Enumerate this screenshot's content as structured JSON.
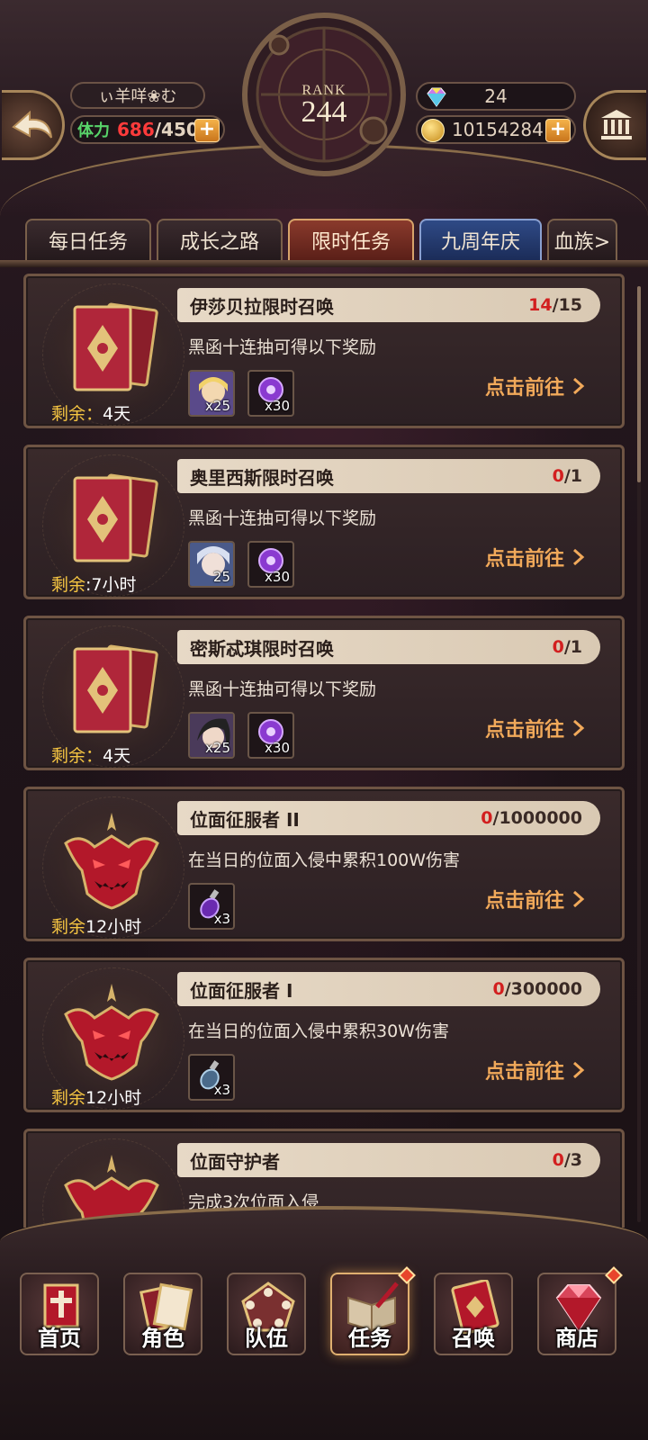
{
  "header": {
    "player_name": "ぃ羊咩❀む",
    "stamina_label": "体力",
    "stamina_current": "686",
    "stamina_max": "/450",
    "rank_label": "RANK",
    "rank_value": "244",
    "gems": "24",
    "gold": "10154284"
  },
  "tabs": [
    {
      "label": "每日任务"
    },
    {
      "label": "成长之路"
    },
    {
      "label": "限时任务"
    },
    {
      "label": "九周年庆"
    },
    {
      "label": "血族>"
    }
  ],
  "tasks": [
    {
      "title": "伊莎贝拉限时召唤",
      "progress_cur": "14",
      "progress_total": "/15",
      "desc": "黑函十连抽可得以下奖励",
      "remain_label": "剩余：",
      "remain_value": "4天",
      "reward1_qty": "x25",
      "reward2_qty": "x30",
      "goto": "点击前往"
    },
    {
      "title": "奥里西斯限时召唤",
      "progress_cur": "0",
      "progress_total": "/1",
      "desc": "黑函十连抽可得以下奖励",
      "remain_label": "剩余",
      "remain_value": ":7小时",
      "reward1_qty": "25",
      "reward2_qty": "x30",
      "goto": "点击前往"
    },
    {
      "title": "密斯忒琪限时召唤",
      "progress_cur": "0",
      "progress_total": "/1",
      "desc": "黑函十连抽可得以下奖励",
      "remain_label": "剩余：",
      "remain_value": "4天",
      "reward1_qty": "x25",
      "reward2_qty": "x30",
      "goto": "点击前往"
    },
    {
      "title": "位面征服者 II",
      "progress_cur": "0",
      "progress_total": "/1000000",
      "desc": "在当日的位面入侵中累积100W伤害",
      "remain_label": "剩余",
      "remain_value": "12小时",
      "reward1_qty": "x3",
      "goto": "点击前往"
    },
    {
      "title": "位面征服者 I",
      "progress_cur": "0",
      "progress_total": "/300000",
      "desc": "在当日的位面入侵中累积30W伤害",
      "remain_label": "剩余",
      "remain_value": "12小时",
      "reward1_qty": "x3",
      "goto": "点击前往"
    },
    {
      "title": "位面守护者",
      "progress_cur": "0",
      "progress_total": "/3",
      "desc": "完成3次位面入侵"
    }
  ],
  "nav": [
    {
      "label": "首页",
      "icon": "banner-cross-icon"
    },
    {
      "label": "角色",
      "icon": "book-card-icon"
    },
    {
      "label": "队伍",
      "icon": "pentagon-team-icon"
    },
    {
      "label": "任务",
      "icon": "quest-book-icon"
    },
    {
      "label": "召唤",
      "icon": "summon-card-icon"
    },
    {
      "label": "商店",
      "icon": "gem-shop-icon"
    }
  ],
  "colors": {
    "accent_orange": "#f1a95a",
    "progress_red": "#d21f1f",
    "stamina_green": "#58d46a",
    "remain_yellow": "#f5c542"
  }
}
